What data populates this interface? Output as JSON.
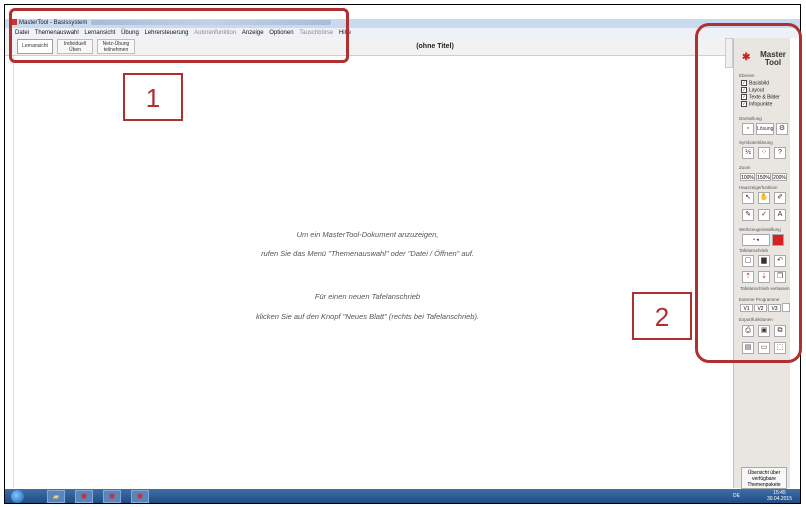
{
  "window": {
    "title": "MasterTool - Basissystem"
  },
  "menu": {
    "items": [
      {
        "label": "Datei",
        "dim": false
      },
      {
        "label": "Themenauswahl",
        "dim": false
      },
      {
        "label": "Lernansicht",
        "dim": false
      },
      {
        "label": "Übung",
        "dim": false
      },
      {
        "label": "Lehrersteuerung",
        "dim": false
      },
      {
        "label": "Autorenfunktion",
        "dim": true
      },
      {
        "label": "Anzeige",
        "dim": false
      },
      {
        "label": "Optionen",
        "dim": false
      },
      {
        "label": "Tauschbörse",
        "dim": true
      },
      {
        "label": "Hilfe",
        "dim": false
      }
    ]
  },
  "tabs": [
    {
      "label": "Lernansicht"
    },
    {
      "label": "Individuell Üben"
    },
    {
      "label": "Netz-Übung teilnehmen"
    }
  ],
  "document": {
    "title": "(ohne Titel)"
  },
  "main": {
    "line1": "Um ein MasterTool-Dokument anzuzeigen,",
    "line2": "rufen Sie das Menü \"Themenauswahl\" oder \"Datei / Öffnen\" auf.",
    "line3": "Für einen neuen Tafelanschrieb",
    "line4": "klicken Sie auf den Knopf \"Neues Blatt\" (rechts bei Tafelanschrieb)."
  },
  "panel": {
    "logo_line1": "Master",
    "logo_line2": "Tool",
    "ebenen_title": "Ebenen",
    "layers": [
      "Basisbild",
      "Layout",
      "Texte & Bilder",
      "Infopunkte"
    ],
    "darstellung_title": "Darstellung",
    "loesung_label": "Lösung",
    "symbolerklaerung_title": "Symbolerklärung",
    "zoom_title": "Zoom",
    "zoom_options": [
      "100%",
      "150%",
      "200%"
    ],
    "hauszeiger_title": "Hauszeigerfunktion",
    "werkzeug_title": "Werkzeugeinstellung",
    "tafel_title": "Tafelanschrieb",
    "tafel_verlassen": "Tafelanschrieb verlassen",
    "externe_title": "Externe Programme",
    "externe_buttons": [
      "V1",
      "V2",
      "V3"
    ],
    "export_title": "Exportfunktionen",
    "overview_label": "Übersicht über verfügbare Themenpakete"
  },
  "taskbar": {
    "lang": "DE",
    "time": "15:45",
    "date": "30.04.2015"
  },
  "annotations": {
    "label1": "1",
    "label2": "2"
  },
  "colors": {
    "annotation": "#b03030",
    "accent_red": "#cc2222"
  }
}
